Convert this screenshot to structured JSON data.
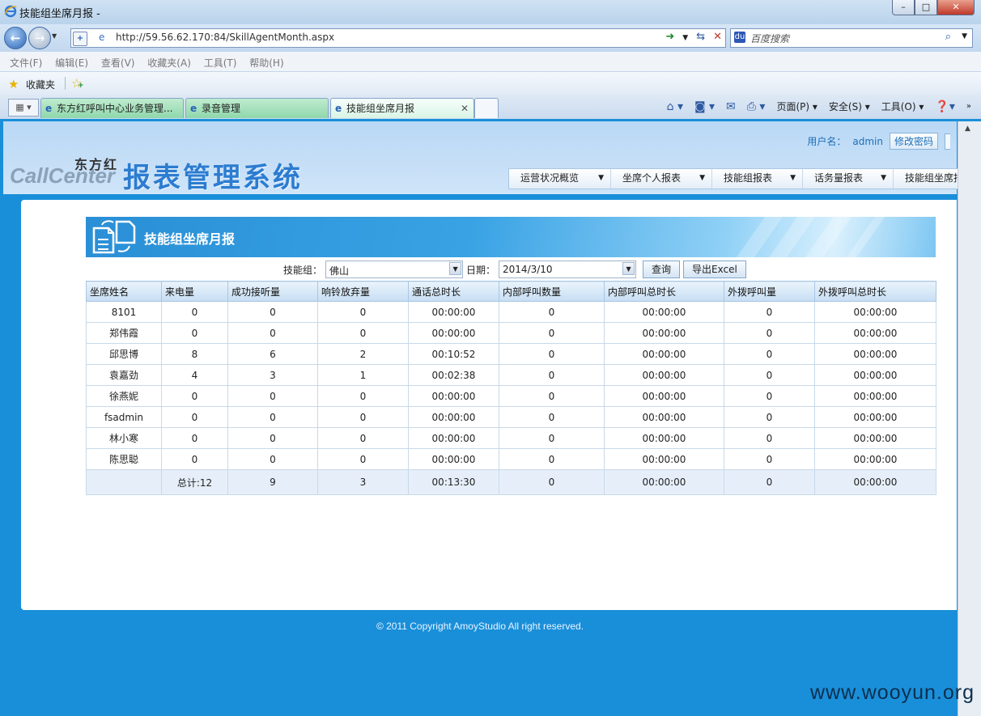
{
  "window": {
    "title": "技能组坐席月报 -",
    "controls": [
      "–",
      "□",
      "✕"
    ]
  },
  "address": {
    "url": "http://59.56.62.170:84/SkillAgentMonth.aspx",
    "search_placeholder": "百度搜索"
  },
  "menu": [
    "文件(F)",
    "编辑(E)",
    "查看(V)",
    "收藏夹(A)",
    "工具(T)",
    "帮助(H)"
  ],
  "favorites": {
    "label": "收藏夹"
  },
  "tabs": [
    {
      "label": "东方红呼叫中心业务管理..."
    },
    {
      "label": "录音管理"
    },
    {
      "label": "技能组坐席月报"
    }
  ],
  "commands": [
    "页面(P)",
    "安全(S)",
    "工具(O)"
  ],
  "user": {
    "label": "用户名：",
    "name": "admin",
    "change_pwd": "修改密码"
  },
  "logo": {
    "brand": "东方红",
    "callcenter": "CallCenter",
    "system": "报表管理系统"
  },
  "nav": [
    "运营状况概览",
    "坐席个人报表",
    "技能组报表",
    "话务量报表",
    "技能组坐席报"
  ],
  "banner": {
    "title": "技能组坐席月报"
  },
  "filters": {
    "group_label": "技能组：",
    "group_value": "佛山",
    "date_label": "日期：",
    "date_value": "2014/3/10",
    "query": "查询",
    "export": "导出Excel"
  },
  "table": {
    "columns": [
      "坐席姓名",
      "来电量",
      "成功接听量",
      "响铃放弃量",
      "通话总时长",
      "内部呼叫数量",
      "内部呼叫总时长",
      "外拨呼叫量",
      "外拨呼叫总时长"
    ],
    "rows": [
      [
        "8101",
        "0",
        "0",
        "0",
        "00:00:00",
        "0",
        "00:00:00",
        "0",
        "00:00:00"
      ],
      [
        "郑伟霞",
        "0",
        "0",
        "0",
        "00:00:00",
        "0",
        "00:00:00",
        "0",
        "00:00:00"
      ],
      [
        "邱思博",
        "8",
        "6",
        "2",
        "00:10:52",
        "0",
        "00:00:00",
        "0",
        "00:00:00"
      ],
      [
        "袁嘉劲",
        "4",
        "3",
        "1",
        "00:02:38",
        "0",
        "00:00:00",
        "0",
        "00:00:00"
      ],
      [
        "徐燕妮",
        "0",
        "0",
        "0",
        "00:00:00",
        "0",
        "00:00:00",
        "0",
        "00:00:00"
      ],
      [
        "fsadmin",
        "0",
        "0",
        "0",
        "00:00:00",
        "0",
        "00:00:00",
        "0",
        "00:00:00"
      ],
      [
        "林小寒",
        "0",
        "0",
        "0",
        "00:00:00",
        "0",
        "00:00:00",
        "0",
        "00:00:00"
      ],
      [
        "陈思聪",
        "0",
        "0",
        "0",
        "00:00:00",
        "0",
        "00:00:00",
        "0",
        "00:00:00"
      ]
    ],
    "total": [
      "",
      "总计:12",
      "9",
      "3",
      "00:13:30",
      "0",
      "00:00:00",
      "0",
      "00:00:00"
    ]
  },
  "footer": "© 2011 Copyright AmoyStudio All right reserved.",
  "watermark": "www.wooyun.org",
  "colors": {
    "page_blue": "#1a8fd9",
    "banner_blue": "#2a8fd6",
    "header_text": "#2c7cd0"
  }
}
